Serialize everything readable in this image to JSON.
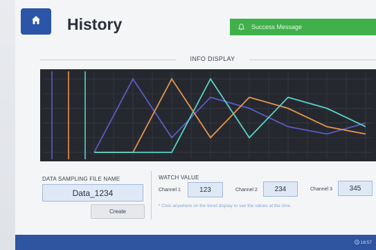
{
  "header": {
    "title": "History",
    "toast": "Success Message"
  },
  "section": {
    "title": "INFO DISPLAY"
  },
  "chart_data": {
    "type": "line",
    "x": [
      0,
      1,
      2,
      3,
      4,
      5,
      6,
      7
    ],
    "series": [
      {
        "color": "#5a5cc4",
        "values": [
          0,
          100,
          20,
          75,
          60,
          35,
          25,
          40
        ]
      },
      {
        "color": "#e8954a",
        "values": [
          0,
          0,
          100,
          20,
          75,
          60,
          35,
          25
        ]
      },
      {
        "color": "#58d3c8",
        "values": [
          0,
          0,
          0,
          100,
          20,
          75,
          60,
          35
        ]
      }
    ],
    "ylim": [
      0,
      100
    ],
    "grid": true
  },
  "sampling": {
    "label": "DATA SAMPLING FILE NAME",
    "filename": "Data_1234",
    "create_label": "Create"
  },
  "watch": {
    "label": "WATCH VALUE",
    "channels": [
      {
        "name": "Channel 1",
        "value": "123"
      },
      {
        "name": "Channel 2",
        "value": "234"
      },
      {
        "name": "Channel 3",
        "value": "345"
      }
    ],
    "hint": "* Click anywhere on the trend display to see the values at the time."
  },
  "footer": {
    "time": "18:57"
  },
  "colors": {
    "brand": "#2b56a7",
    "success": "#3fb04a"
  }
}
